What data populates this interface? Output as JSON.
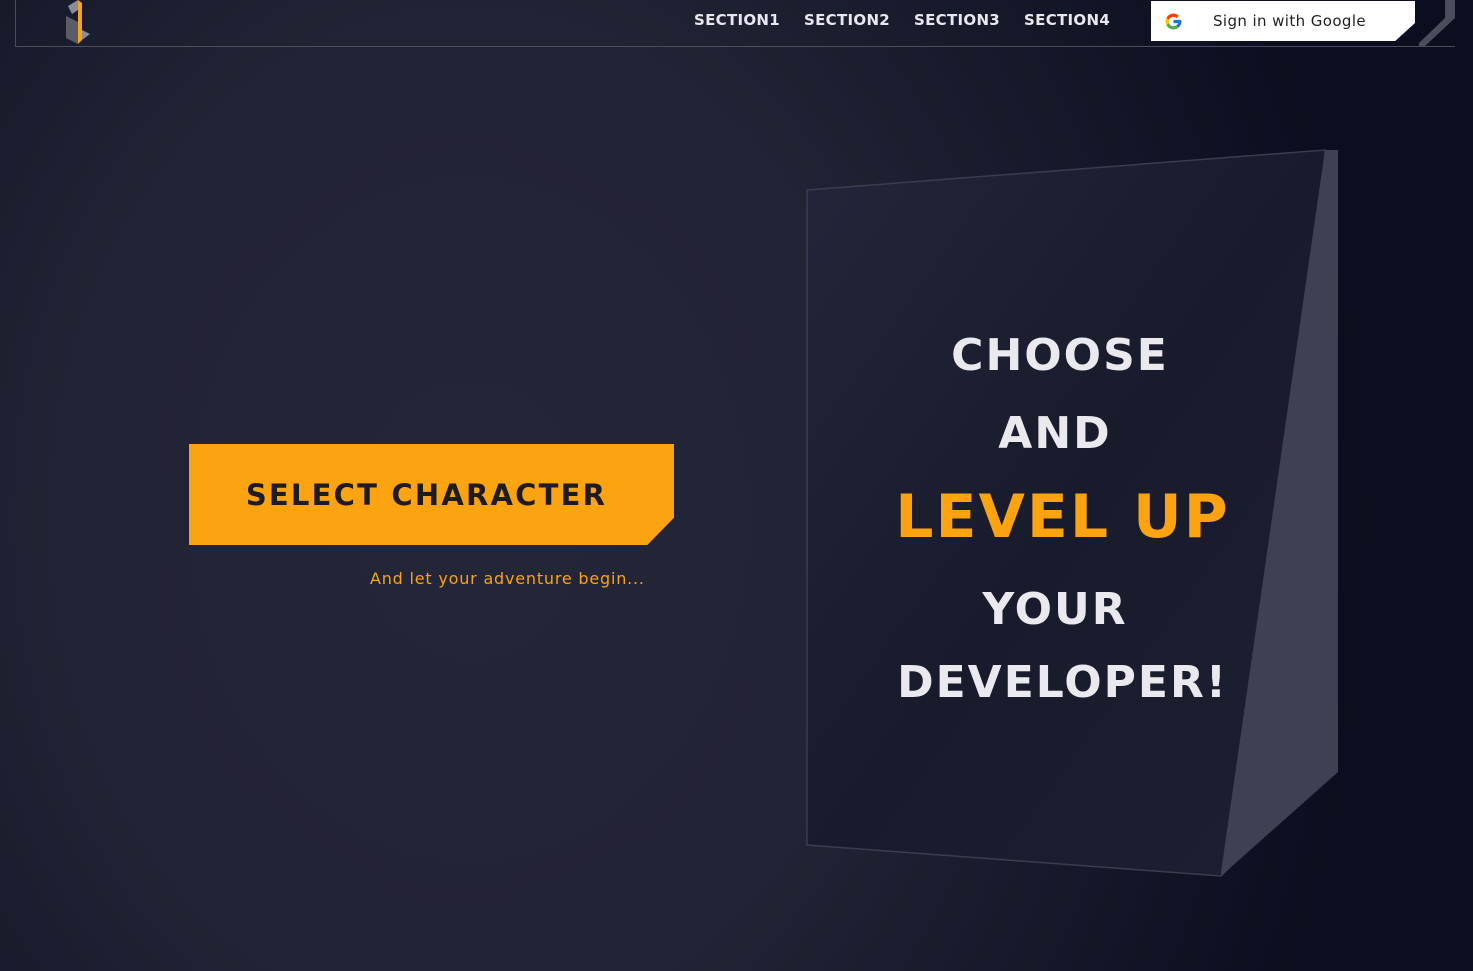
{
  "header": {
    "logo_icon": "brand-logo-icon",
    "nav": [
      "SECTION1",
      "SECTION2",
      "SECTION3",
      "SECTION4"
    ],
    "google_signin": {
      "label": "Sign in with Google",
      "icon": "google-g-icon"
    }
  },
  "hero": {
    "button_label": "SELECT CHARACTER",
    "tagline": "And let your adventure begin...",
    "panel_lines": [
      "CHOOSE",
      "AND",
      "LEVEL UP",
      "YOUR",
      "DEVELOPER!"
    ]
  },
  "colors": {
    "accent": "#fca311",
    "background": "#212434",
    "text": "#e9e9ee"
  }
}
